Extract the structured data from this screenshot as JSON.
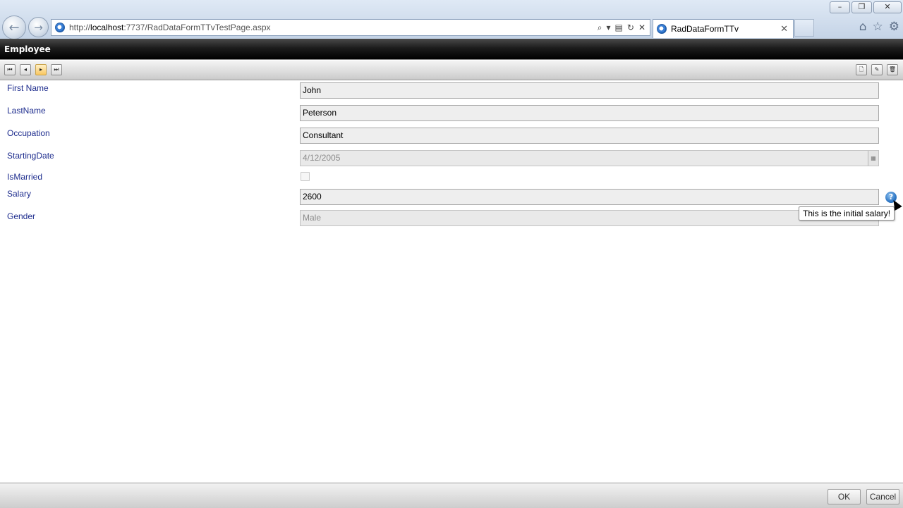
{
  "browser": {
    "url_prefix": "http://",
    "url_host": "localhost",
    "url_rest": ":7737/RadDataFormTTvTestPage.aspx",
    "tab_title": "RadDataFormTTv",
    "icons": [
      "back-arrow-icon",
      "forward-arrow-icon",
      "ie-logo-icon",
      "search-icon",
      "dropdown-icon",
      "compat-view-icon",
      "refresh-icon",
      "stop-icon",
      "home-icon",
      "favorites-star-icon",
      "gear-icon"
    ]
  },
  "form": {
    "header": "Employee",
    "toolbar": {
      "first": "⏮",
      "prev": "◂",
      "next": "▸",
      "last": "⏭",
      "add": "🗋",
      "edit": "✎",
      "delete": "🗑"
    },
    "fields": [
      {
        "label": "First Name",
        "value": "John"
      },
      {
        "label": "LastName",
        "value": "Peterson"
      },
      {
        "label": "Occupation",
        "value": "Consultant"
      },
      {
        "label": "StartingDate",
        "value": "4/12/2005"
      },
      {
        "label": "IsMarried",
        "checked": false
      },
      {
        "label": "Salary",
        "value": "2600"
      },
      {
        "label": "Gender",
        "value": "Male"
      }
    ],
    "tooltip": "This is the initial salary!",
    "help_glyph": "?",
    "ok_label": "OK",
    "cancel_label": "Cancel"
  },
  "colors": {
    "label_color": "#1e2d8e",
    "header_bg": "#000000",
    "help_icon": "#2d76c4"
  }
}
